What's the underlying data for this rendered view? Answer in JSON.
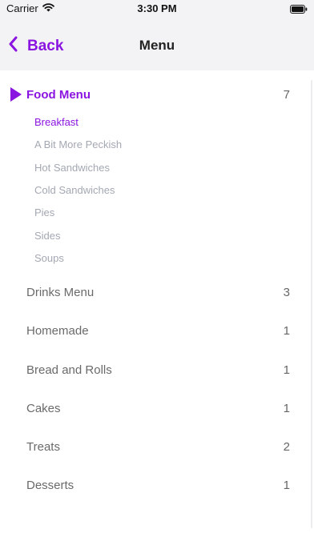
{
  "status_bar": {
    "carrier": "Carrier",
    "time": "3:30 PM"
  },
  "navbar": {
    "back_label": "Back",
    "title": "Menu"
  },
  "food_menu": {
    "label": "Food Menu",
    "count": "7",
    "items": [
      {
        "label": "Breakfast",
        "selected": true
      },
      {
        "label": "A Bit More Peckish",
        "selected": false
      },
      {
        "label": "Hot Sandwiches",
        "selected": false
      },
      {
        "label": "Cold Sandwiches",
        "selected": false
      },
      {
        "label": "Pies",
        "selected": false
      },
      {
        "label": "Sides",
        "selected": false
      },
      {
        "label": "Soups",
        "selected": false
      }
    ]
  },
  "categories": [
    {
      "label": "Drinks Menu",
      "count": "3"
    },
    {
      "label": "Homemade",
      "count": "1"
    },
    {
      "label": "Bread and Rolls",
      "count": "1"
    },
    {
      "label": "Cakes",
      "count": "1"
    },
    {
      "label": "Treats",
      "count": "2"
    },
    {
      "label": "Desserts",
      "count": "1"
    }
  ],
  "colors": {
    "accent": "#8a14e0",
    "muted_text": "#a4a8b3",
    "category_text": "#6a6a6a",
    "bar_background": "#f3f3f5"
  },
  "icons": {
    "wifi": "wifi-icon",
    "battery": "battery-icon",
    "back": "chevron-left-icon",
    "expanded": "play-triangle-icon"
  }
}
